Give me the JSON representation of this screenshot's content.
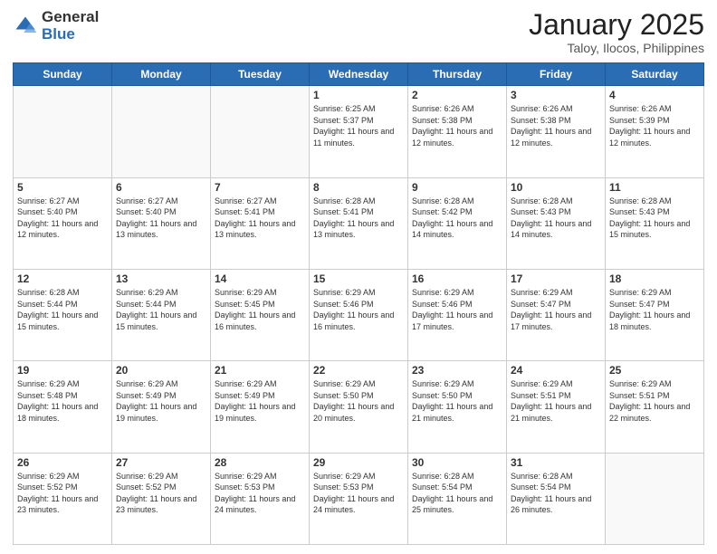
{
  "logo": {
    "general": "General",
    "blue": "Blue"
  },
  "title": "January 2025",
  "location": "Taloy, Ilocos, Philippines",
  "days_header": [
    "Sunday",
    "Monday",
    "Tuesday",
    "Wednesday",
    "Thursday",
    "Friday",
    "Saturday"
  ],
  "weeks": [
    [
      {
        "num": "",
        "info": ""
      },
      {
        "num": "",
        "info": ""
      },
      {
        "num": "",
        "info": ""
      },
      {
        "num": "1",
        "info": "Sunrise: 6:25 AM\nSunset: 5:37 PM\nDaylight: 11 hours and 11 minutes."
      },
      {
        "num": "2",
        "info": "Sunrise: 6:26 AM\nSunset: 5:38 PM\nDaylight: 11 hours and 12 minutes."
      },
      {
        "num": "3",
        "info": "Sunrise: 6:26 AM\nSunset: 5:38 PM\nDaylight: 11 hours and 12 minutes."
      },
      {
        "num": "4",
        "info": "Sunrise: 6:26 AM\nSunset: 5:39 PM\nDaylight: 11 hours and 12 minutes."
      }
    ],
    [
      {
        "num": "5",
        "info": "Sunrise: 6:27 AM\nSunset: 5:40 PM\nDaylight: 11 hours and 12 minutes."
      },
      {
        "num": "6",
        "info": "Sunrise: 6:27 AM\nSunset: 5:40 PM\nDaylight: 11 hours and 13 minutes."
      },
      {
        "num": "7",
        "info": "Sunrise: 6:27 AM\nSunset: 5:41 PM\nDaylight: 11 hours and 13 minutes."
      },
      {
        "num": "8",
        "info": "Sunrise: 6:28 AM\nSunset: 5:41 PM\nDaylight: 11 hours and 13 minutes."
      },
      {
        "num": "9",
        "info": "Sunrise: 6:28 AM\nSunset: 5:42 PM\nDaylight: 11 hours and 14 minutes."
      },
      {
        "num": "10",
        "info": "Sunrise: 6:28 AM\nSunset: 5:43 PM\nDaylight: 11 hours and 14 minutes."
      },
      {
        "num": "11",
        "info": "Sunrise: 6:28 AM\nSunset: 5:43 PM\nDaylight: 11 hours and 15 minutes."
      }
    ],
    [
      {
        "num": "12",
        "info": "Sunrise: 6:28 AM\nSunset: 5:44 PM\nDaylight: 11 hours and 15 minutes."
      },
      {
        "num": "13",
        "info": "Sunrise: 6:29 AM\nSunset: 5:44 PM\nDaylight: 11 hours and 15 minutes."
      },
      {
        "num": "14",
        "info": "Sunrise: 6:29 AM\nSunset: 5:45 PM\nDaylight: 11 hours and 16 minutes."
      },
      {
        "num": "15",
        "info": "Sunrise: 6:29 AM\nSunset: 5:46 PM\nDaylight: 11 hours and 16 minutes."
      },
      {
        "num": "16",
        "info": "Sunrise: 6:29 AM\nSunset: 5:46 PM\nDaylight: 11 hours and 17 minutes."
      },
      {
        "num": "17",
        "info": "Sunrise: 6:29 AM\nSunset: 5:47 PM\nDaylight: 11 hours and 17 minutes."
      },
      {
        "num": "18",
        "info": "Sunrise: 6:29 AM\nSunset: 5:47 PM\nDaylight: 11 hours and 18 minutes."
      }
    ],
    [
      {
        "num": "19",
        "info": "Sunrise: 6:29 AM\nSunset: 5:48 PM\nDaylight: 11 hours and 18 minutes."
      },
      {
        "num": "20",
        "info": "Sunrise: 6:29 AM\nSunset: 5:49 PM\nDaylight: 11 hours and 19 minutes."
      },
      {
        "num": "21",
        "info": "Sunrise: 6:29 AM\nSunset: 5:49 PM\nDaylight: 11 hours and 19 minutes."
      },
      {
        "num": "22",
        "info": "Sunrise: 6:29 AM\nSunset: 5:50 PM\nDaylight: 11 hours and 20 minutes."
      },
      {
        "num": "23",
        "info": "Sunrise: 6:29 AM\nSunset: 5:50 PM\nDaylight: 11 hours and 21 minutes."
      },
      {
        "num": "24",
        "info": "Sunrise: 6:29 AM\nSunset: 5:51 PM\nDaylight: 11 hours and 21 minutes."
      },
      {
        "num": "25",
        "info": "Sunrise: 6:29 AM\nSunset: 5:51 PM\nDaylight: 11 hours and 22 minutes."
      }
    ],
    [
      {
        "num": "26",
        "info": "Sunrise: 6:29 AM\nSunset: 5:52 PM\nDaylight: 11 hours and 23 minutes."
      },
      {
        "num": "27",
        "info": "Sunrise: 6:29 AM\nSunset: 5:52 PM\nDaylight: 11 hours and 23 minutes."
      },
      {
        "num": "28",
        "info": "Sunrise: 6:29 AM\nSunset: 5:53 PM\nDaylight: 11 hours and 24 minutes."
      },
      {
        "num": "29",
        "info": "Sunrise: 6:29 AM\nSunset: 5:53 PM\nDaylight: 11 hours and 24 minutes."
      },
      {
        "num": "30",
        "info": "Sunrise: 6:28 AM\nSunset: 5:54 PM\nDaylight: 11 hours and 25 minutes."
      },
      {
        "num": "31",
        "info": "Sunrise: 6:28 AM\nSunset: 5:54 PM\nDaylight: 11 hours and 26 minutes."
      },
      {
        "num": "",
        "info": ""
      }
    ]
  ]
}
